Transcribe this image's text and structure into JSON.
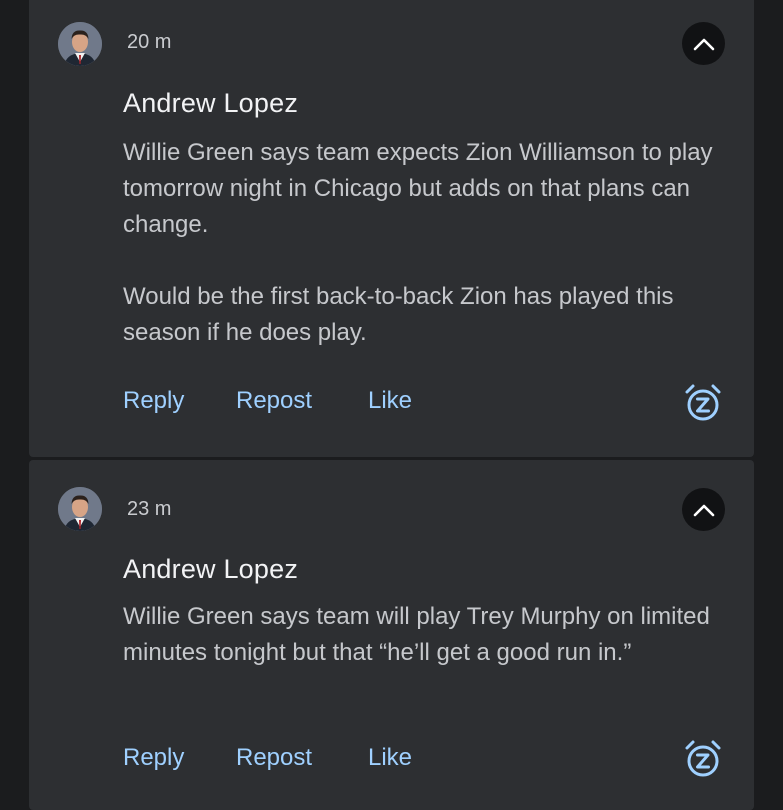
{
  "posts": [
    {
      "time": "20 m",
      "author": "Andrew Lopez",
      "paragraphs": [
        "Willie Green says team expects Zion Williamson to play tomorrow night in Chicago but adds on that plans can change.",
        "Would be the first back-to-back Zion has played this season if he does play."
      ],
      "actions": {
        "reply": "Reply",
        "repost": "Repost",
        "like": "Like"
      },
      "icons": {
        "collapse": "chevron-up-icon",
        "snooze": "snooze-alarm-icon",
        "avatar": "person-avatar"
      }
    },
    {
      "time": "23 m",
      "author": "Andrew Lopez",
      "paragraphs": [
        "Willie Green says team will play Trey Murphy on limited minutes tonight but that “he’ll get a good run in.”"
      ],
      "actions": {
        "reply": "Reply",
        "repost": "Repost",
        "like": "Like"
      },
      "icons": {
        "collapse": "chevron-up-icon",
        "snooze": "snooze-alarm-icon",
        "avatar": "person-avatar"
      }
    }
  ],
  "colors": {
    "background": "#1b1c1e",
    "card": "#2d2f32",
    "action_link": "#9fd0ff",
    "body_text": "#c6c8cc",
    "author_text": "#f2f3f5"
  }
}
